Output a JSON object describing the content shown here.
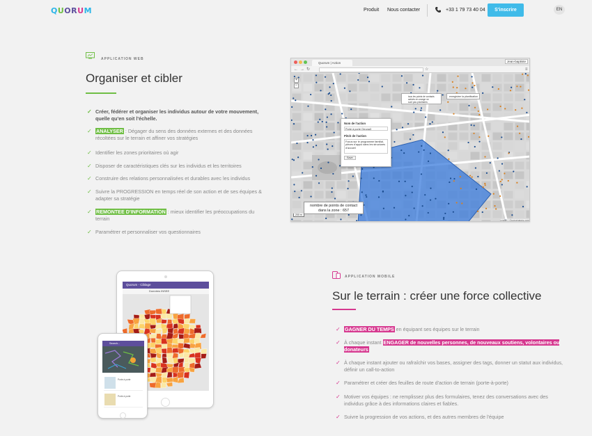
{
  "header": {
    "logo_letters": [
      {
        "ch": "Q",
        "color": "#2ab5e8"
      },
      {
        "ch": "U",
        "color": "#6fbe44"
      },
      {
        "ch": "O",
        "color": "#5d4e9c"
      },
      {
        "ch": "R",
        "color": "#5d4e9c"
      },
      {
        "ch": "U",
        "color": "#d6388f"
      },
      {
        "ch": "M",
        "color": "#2ab5e8"
      }
    ],
    "nav": [
      "Produit",
      "Nous contacter"
    ],
    "phone": "+33 1 79 73 40 04",
    "signup": "S'inscrire",
    "lang": "EN"
  },
  "web": {
    "eyebrow": "APPLICATION WEB",
    "title": "Organiser et cibler",
    "accent": "#6fbe44",
    "features": [
      {
        "text": "Créer, fédérer et organiser les individus autour de votre mouvement, quelle qu'en soit l'échelle.",
        "bold": true
      },
      {
        "highlight": "ANALYSER",
        "text": " : Dégager du sens des données externes et des données récoltées sur le terrain et affiner vos stratégies"
      },
      {
        "text": "Identifier les zones prioritaires où agir"
      },
      {
        "text": "Disposer de caractéristiques clés sur les individus et les territoires"
      },
      {
        "text": "Construire des relations personnalisées et durables avec les individus"
      },
      {
        "text": "Suivre la PROGRESSION en temps réel de son action et de ses équipes & adapter sa stratégie"
      },
      {
        "highlight": "REMONTEE D'INFORMATION",
        "text": " : mieux identifier les préoccupations du terrain"
      },
      {
        "text": "Paramétrer et personnaliser vos questionnaires"
      }
    ]
  },
  "browser": {
    "tab": "Quorum | Action",
    "user": "Jean-baptiste",
    "popup": {
      "name_label": "Nom de l'action",
      "name_value": "Porte à porte Orruna3",
      "pitch_label": "Pitch de l'action",
      "pitch_value": "Focus sur le programme familial, pièces d'appui dans les structures d'accueil",
      "save": "Save"
    },
    "legend": "tous les points de contacts\nactivés en orange ne\nsont pas prioritaires",
    "btn2": "enregistrer la planification",
    "tooltip_line1": "nombre de points de contact",
    "tooltip_line2": "dans la zone : 657",
    "attribution": "Leaflet | Quorumapps.com",
    "scale": "200 m",
    "zoom": [
      "+",
      "−"
    ]
  },
  "mobile": {
    "eyebrow": "APPLICATION MOBILE",
    "title": "Sur le terrain : créer une force collective",
    "accent": "#d6388f",
    "features": [
      {
        "highlight": "GAGNER DU TEMPS",
        "text": " en équipant ses équipes sur le terrain"
      },
      {
        "pre": "À chaque instant ",
        "highlight": "ENGAGER de nouvelles personnes, de nouveaux soutiens, volontaires ou donateurs",
        "text": ""
      },
      {
        "text": "À chaque instant ajouter ou rafraîchir vos bases, assigner des tags, donner un statut aux individus, définir un call-to-action"
      },
      {
        "text": "Paramétrer et créer des feuilles de route d'action de terrain (porte-à-porte)"
      },
      {
        "text": "Motiver vos équipes : ne remplissez plus des formulaires, tenez des conversations avec des individus grâce à des informations claires et fiables."
      },
      {
        "text": "Suivre la progression de vos actions, et des autres membres de l'équipe"
      }
    ]
  },
  "tablet": {
    "bar": "Quorum - Ciblage",
    "sub": "Données INSEE"
  },
  "phone": {
    "bar": "Search...",
    "card1": "Porte à porte",
    "card2": "Porte à porte"
  },
  "colors": {
    "signup": "#40bbe9",
    "green": "#6fbe44",
    "pink": "#d6388f",
    "purple": "#5d4e9c"
  }
}
